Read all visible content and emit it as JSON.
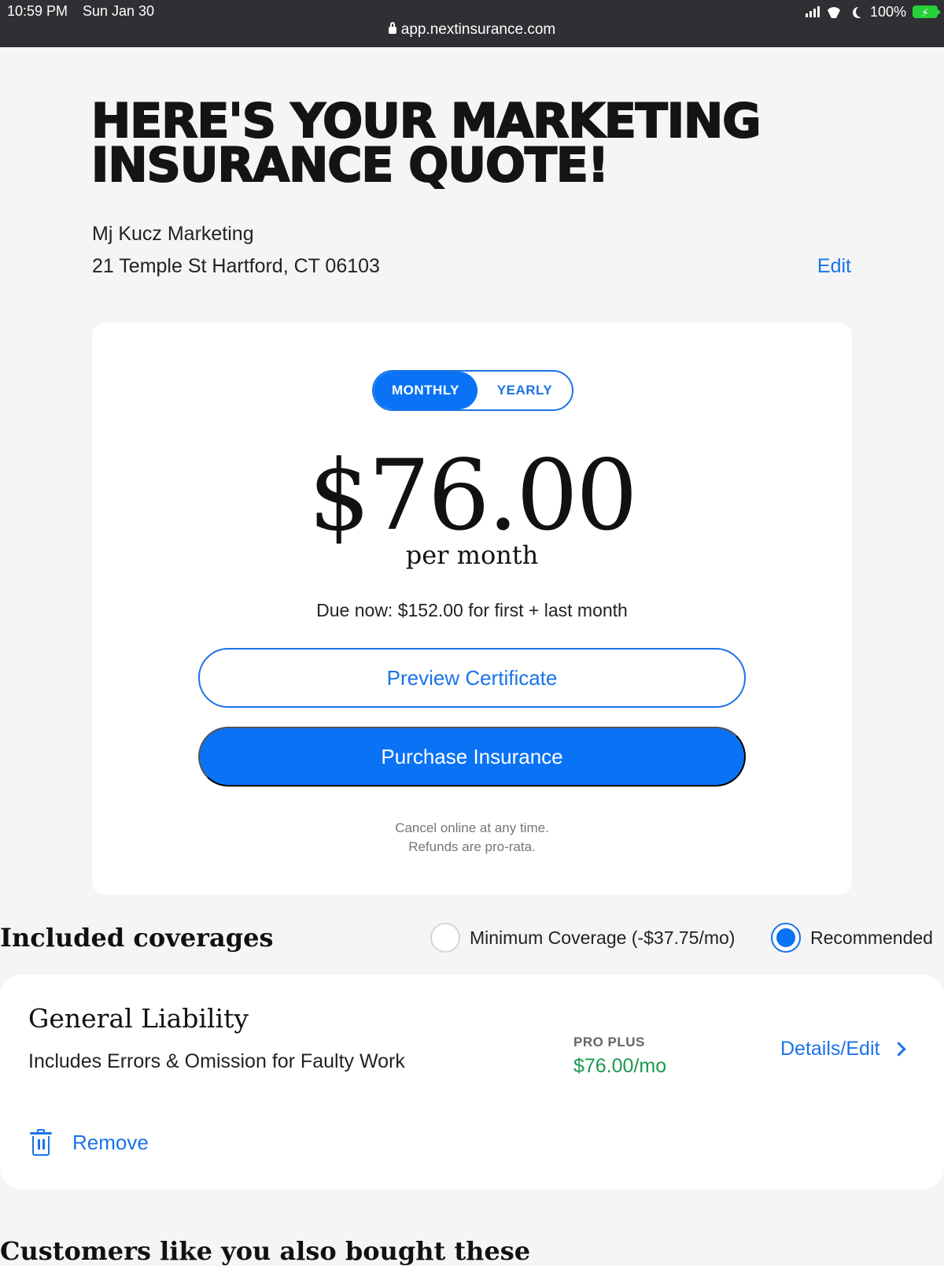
{
  "status_bar": {
    "time": "10:59 PM",
    "date": "Sun Jan 30",
    "url": "app.nextinsurance.com",
    "battery_pct": "100%"
  },
  "header": {
    "title_line1": "HERE'S YOUR MARKETING",
    "title_line2": "INSURANCE QUOTE!",
    "business_name": "Mj Kucz Marketing",
    "business_address": "21 Temple St Hartford, CT 06103",
    "edit_label": "Edit"
  },
  "quote": {
    "toggle": {
      "monthly": "MONTHLY",
      "yearly": "YEARLY",
      "selected": "monthly"
    },
    "price": "$76.00",
    "period": "per month",
    "due_now": "Due now: $152.00 for first + last month",
    "preview_button": "Preview Certificate",
    "purchase_button": "Purchase Insurance",
    "fine_print_1": "Cancel online at any time.",
    "fine_print_2": "Refunds are pro-rata."
  },
  "coverages": {
    "title": "Included coverages",
    "options": [
      {
        "label": "Minimum Coverage (-$37.75/mo)",
        "checked": false
      },
      {
        "label": "Recommended",
        "checked": true
      }
    ],
    "items": [
      {
        "title": "General Liability",
        "description": "Includes Errors & Omission for Faulty Work",
        "tier": "PRO PLUS",
        "price": "$76.00/mo",
        "details_label": "Details/Edit",
        "remove_label": "Remove"
      }
    ]
  },
  "also_bought": {
    "title": "Customers like you also bought these"
  },
  "colors": {
    "accent": "#0a73f5",
    "price_green": "#1a9a4d",
    "background": "#f5f5f5"
  }
}
